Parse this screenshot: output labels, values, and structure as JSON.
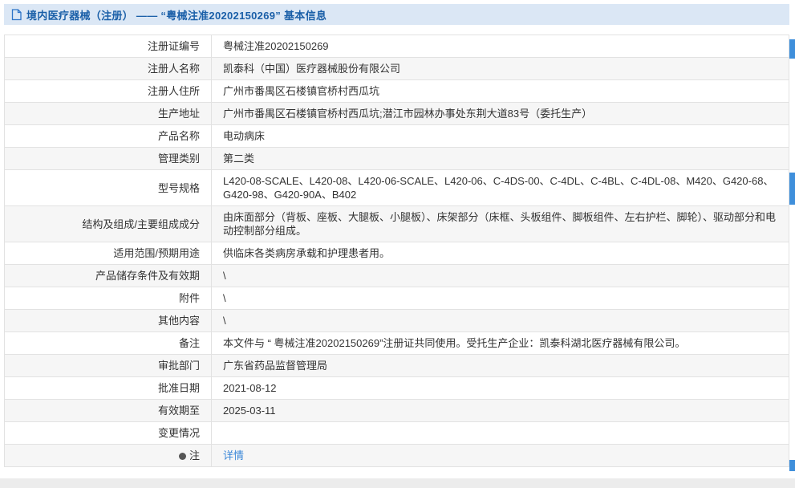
{
  "header": {
    "icon": "document-icon",
    "title": "境内医疗器械（注册） ——  “粤械注准20202150269” 基本信息"
  },
  "table": {
    "rows": [
      {
        "label": "注册证编号",
        "value": "粤械注准20202150269"
      },
      {
        "label": "注册人名称",
        "value": "凯泰科（中国）医疗器械股份有限公司"
      },
      {
        "label": "注册人住所",
        "value": "广州市番禺区石楼镇官桥村西瓜坑"
      },
      {
        "label": "生产地址",
        "value": "广州市番禺区石楼镇官桥村西瓜坑;潜江市园林办事处东荆大道83号（委托生产）"
      },
      {
        "label": "产品名称",
        "value": "电动病床"
      },
      {
        "label": "管理类别",
        "value": "第二类"
      },
      {
        "label": "型号规格",
        "value": "L420-08-SCALE、L420-08、L420-06-SCALE、L420-06、C-4DS-00、C-4DL、C-4BL、C-4DL-08、M420、G420-68、G420-98、G420-90A、B402"
      },
      {
        "label": "结构及组成/主要组成成分",
        "value": "由床面部分（背板、座板、大腿板、小腿板）、床架部分（床框、头板组件、脚板组件、左右护栏、脚轮）、驱动部分和电动控制部分组成。"
      },
      {
        "label": "适用范围/预期用途",
        "value": "供临床各类病房承载和护理患者用。"
      },
      {
        "label": "产品储存条件及有效期",
        "value": "\\"
      },
      {
        "label": "附件",
        "value": "\\"
      },
      {
        "label": "其他内容",
        "value": "\\"
      },
      {
        "label": "备注",
        "value": "本文件与 “ 粤械注准20202150269”注册证共同使用。受托生产企业：凯泰科湖北医疗器械有限公司。"
      },
      {
        "label": "审批部门",
        "value": "广东省药品监督管理局"
      },
      {
        "label": "批准日期",
        "value": "2021-08-12"
      },
      {
        "label": "有效期至",
        "value": "2025-03-11"
      },
      {
        "label": "变更情况",
        "value": ""
      },
      {
        "label": "注",
        "value": "详情"
      }
    ]
  },
  "colors": {
    "header_bg": "#dbe7f5",
    "title_text": "#1a5fa8",
    "link": "#3a87d8",
    "row_alt_bg": "#f6f6f6",
    "border": "#e2e2e2",
    "edge_marker": "#3f8fdb"
  }
}
